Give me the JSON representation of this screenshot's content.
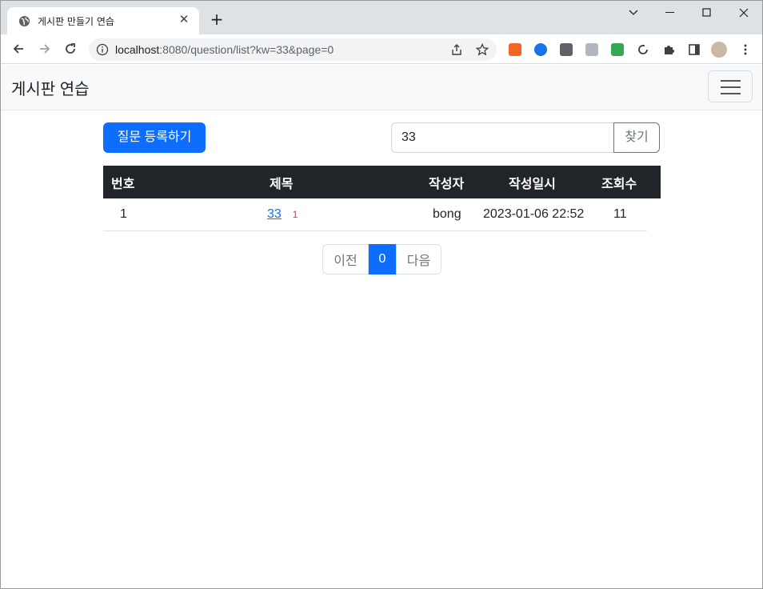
{
  "browser": {
    "tab_title": "게시판 만들기 연습",
    "url_host": "localhost",
    "url_rest": ":8080/question/list?kw=33&page=0"
  },
  "navbar": {
    "brand": "게시판 연습"
  },
  "actions": {
    "create_button": "질문 등록하기",
    "search_value": "33",
    "search_button": "찾기"
  },
  "table": {
    "headers": [
      "번호",
      "제목",
      "작성자",
      "작성일시",
      "조회수"
    ],
    "rows": [
      {
        "no": "1",
        "title": "33",
        "comments": "1",
        "author": "bong",
        "date": "2023-01-06 22:52",
        "views": "11"
      }
    ]
  },
  "pagination": {
    "prev": "이전",
    "current": "0",
    "next": "다음"
  },
  "colors": {
    "primary": "#0d6efd",
    "dark": "#212529",
    "danger": "#dc3545"
  }
}
